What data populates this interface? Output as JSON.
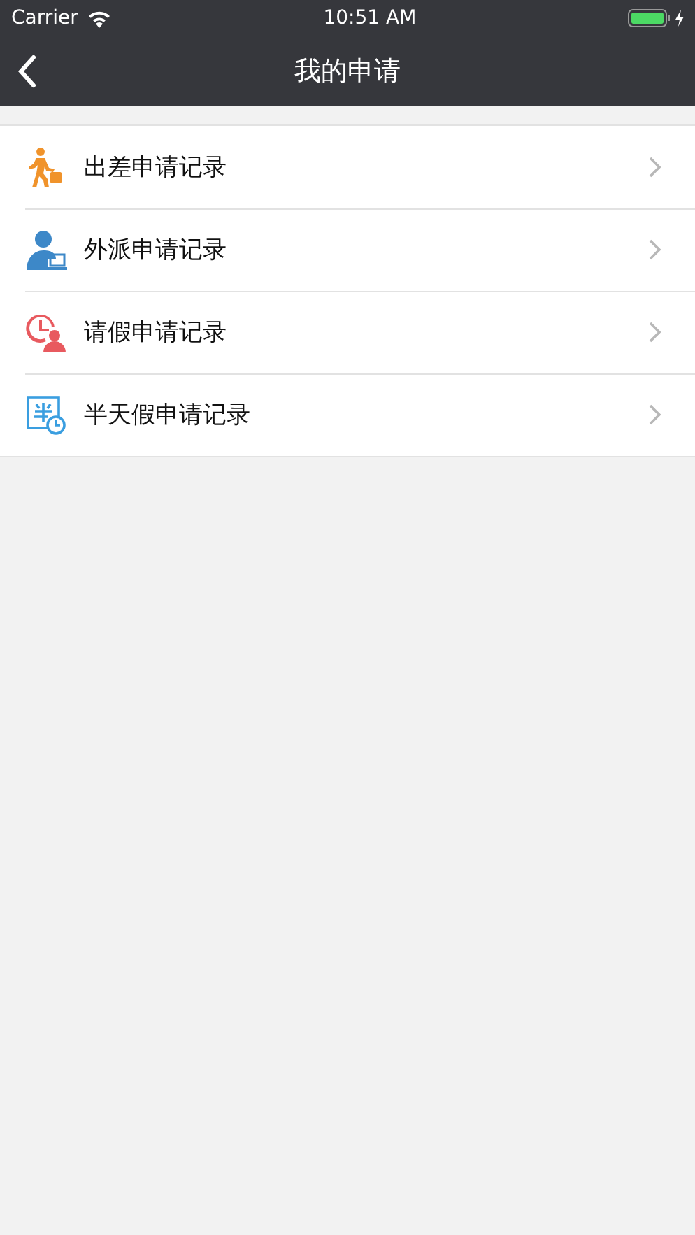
{
  "status_bar": {
    "carrier": "Carrier",
    "time": "10:51 AM"
  },
  "nav": {
    "title": "我的申请"
  },
  "items": [
    {
      "kind": "trip",
      "label": "出差申请记录"
    },
    {
      "kind": "dispatch",
      "label": "外派申请记录"
    },
    {
      "kind": "leave",
      "label": "请假申请记录"
    },
    {
      "kind": "halfday",
      "label": "半天假申请记录"
    }
  ]
}
